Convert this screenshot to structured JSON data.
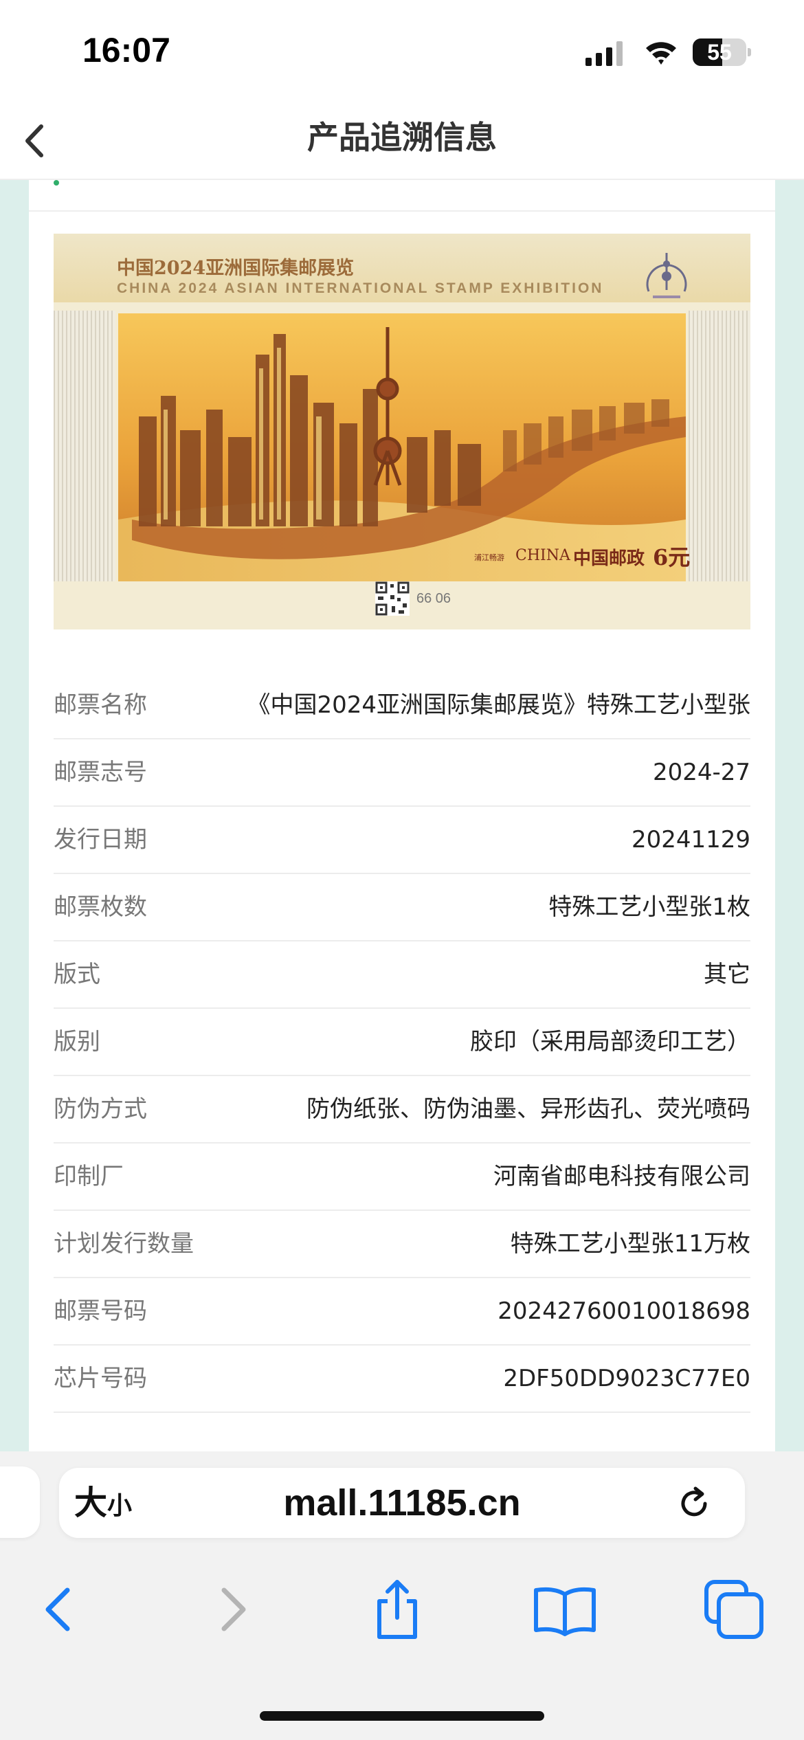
{
  "status_bar": {
    "time": "16:07",
    "battery_percent": 55,
    "battery_label": "55"
  },
  "header": {
    "title": "产品追溯信息",
    "back_icon": "chevron-left-icon"
  },
  "stamp": {
    "cn_title": "中国2024亚洲国际集邮展览",
    "en_title": "CHINA 2024 ASIAN INTERNATIONAL STAMP EXHIBITION",
    "sub_caption": "浦江畅游",
    "country": "CHINA",
    "post_name": "中国邮政",
    "face_value": "6元",
    "serial": "66 06"
  },
  "info": {
    "rows": [
      {
        "label": "邮票名称",
        "value": "《中国2024亚洲国际集邮展览》特殊工艺小型张"
      },
      {
        "label": "邮票志号",
        "value": "2024-27"
      },
      {
        "label": "发行日期",
        "value": "20241129"
      },
      {
        "label": "邮票枚数",
        "value": "特殊工艺小型张1枚"
      },
      {
        "label": "版式",
        "value": "其它"
      },
      {
        "label": "版别",
        "value": "胶印（采用局部烫印工艺）"
      },
      {
        "label": "防伪方式",
        "value": "防伪纸张、防伪油墨、异形齿孔、荧光喷码"
      },
      {
        "label": "印制厂",
        "value": "河南省邮电科技有限公司"
      },
      {
        "label": "计划发行数量",
        "value": "特殊工艺小型张11万枚"
      },
      {
        "label": "邮票号码",
        "value": "20242760010018698"
      },
      {
        "label": "芯片号码",
        "value": "2DF50DD9023C77E0"
      }
    ]
  },
  "browser": {
    "text_size_big": "大",
    "text_size_small": "小",
    "url": "mall.11185.cn",
    "accent_color": "#1a7cf5"
  }
}
